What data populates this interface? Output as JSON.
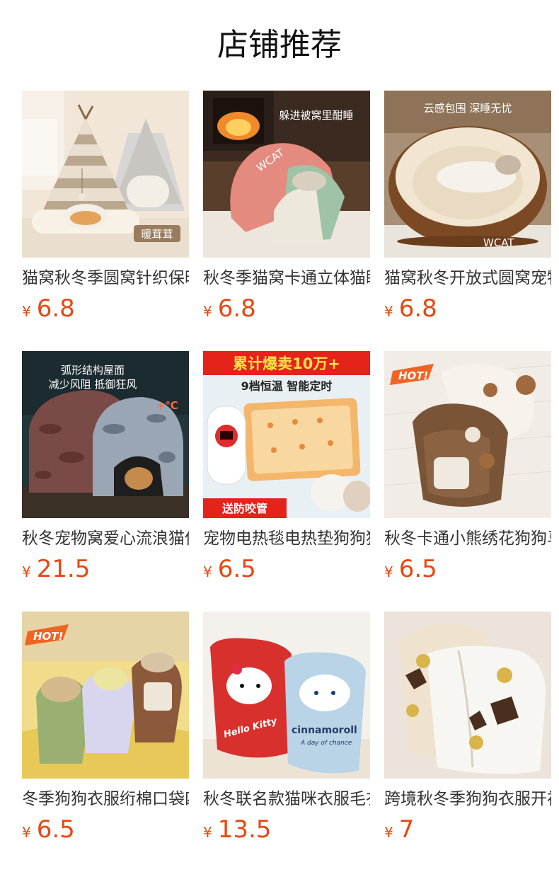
{
  "page_title": "店铺推荐",
  "products": [
    {
      "name": "猫窝秋冬季圆窝针织保暖宠物窝",
      "currency": "¥",
      "price": "6.8",
      "badge": "暖茸茸",
      "icon": "cat-teepee-bed-photo"
    },
    {
      "name": "秋冬季猫窝卡通立体猫睡袋",
      "currency": "¥",
      "price": "6.8",
      "badge": "躲进被窝里酣睡",
      "icon": "cat-sleeping-bag-photo",
      "brand": "WCAT"
    },
    {
      "name": "猫窝秋冬开放式圆窝宠物垫",
      "currency": "¥",
      "price": "6.8",
      "badge": "云感包围 深睡无忧",
      "icon": "round-cat-bed-photo",
      "brand": "WCAT"
    },
    {
      "name": "秋冬宠物窝爱心流浪猫保暖屋",
      "currency": "¥",
      "price": "21.5",
      "badge_line1": "弧形结构屋面",
      "badge_line2": "减少风阻 抵御狂风",
      "temp": "+℃",
      "icon": "camo-outdoor-cat-house-photo"
    },
    {
      "name": "宠物电热毯电热垫狗狗猫咪",
      "currency": "¥",
      "price": "6.5",
      "banner": "累计爆卖10万+",
      "sub_banner": "9档恒温 智能定时",
      "gift": "送防咬管",
      "icon": "pet-heating-pad-photo"
    },
    {
      "name": "秋冬卡通小熊绣花狗狗马甲",
      "currency": "¥",
      "price": "6.5",
      "hot": "HOT!",
      "icon": "bear-fleece-vest-photo"
    },
    {
      "name": "冬季狗狗衣服绗棉口袋四脚衣",
      "currency": "¥",
      "price": "6.5",
      "hot": "HOT!",
      "icon": "dog-winter-jumpsuit-photo"
    },
    {
      "name": "秋冬联名款猫咪衣服毛衣",
      "currency": "¥",
      "price": "13.5",
      "text1": "Hello Kitty",
      "text2": "cinnamoroll",
      "text3": "A day of chance",
      "icon": "cartoon-pet-sweater-photo"
    },
    {
      "name": "跨境秋冬季狗狗衣服开衫",
      "currency": "¥",
      "price": "7",
      "icon": "teddy-fleece-cardigan-photo"
    }
  ],
  "colors": {
    "price": "#e8480f",
    "text": "#333333"
  }
}
